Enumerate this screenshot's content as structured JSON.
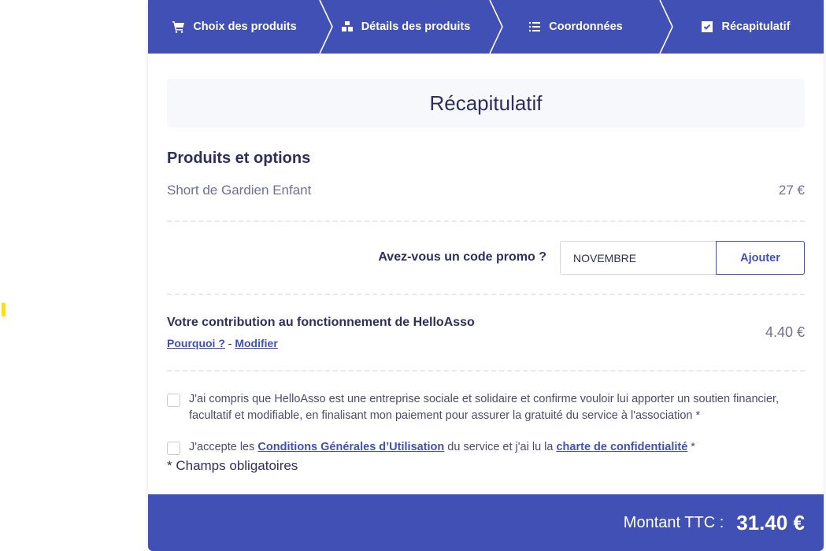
{
  "stepper": {
    "steps": [
      {
        "label": "Choix des produits",
        "icon": "cart-icon"
      },
      {
        "label": "Détails des produits",
        "icon": "boxes-icon"
      },
      {
        "label": "Coordonnées",
        "icon": "list-icon"
      },
      {
        "label": "Récapitulatif",
        "icon": "check-square-icon"
      }
    ]
  },
  "summary": {
    "title": "Récapitulatif",
    "section_title": "Produits et options",
    "product": {
      "name": "Short de Gardien Enfant",
      "price": "27 €"
    }
  },
  "promo": {
    "label": "Avez-vous un code promo ?",
    "value": "NOVEMBRE",
    "button_label": "Ajouter"
  },
  "contribution": {
    "title": "Votre contribution au fonctionnement de HelloAsso",
    "why_link": "Pourquoi ?",
    "separator": "-",
    "modify_link": "Modifier",
    "amount": "4.40 €"
  },
  "consents": {
    "first_line1": "J'ai compris que HelloAsso est une entreprise sociale et solidaire et confirme vouloir lui apporter un soutien financier,",
    "first_line2": "facultatif et modifiable, en finalisant mon paiement pour assurer la gratuité du service à l'association *",
    "second_prefix": "J'accepte les ",
    "second_cgu_link": "Conditions Générales d’Utilisation",
    "second_middle": " du service et j'ai lu la ",
    "second_privacy_link": "charte de confidentialité",
    "second_suffix": " *",
    "required_note": "* Champs obligatoires"
  },
  "footer": {
    "label": "Montant TTC :",
    "amount": "31.40 €"
  },
  "colors": {
    "primary": "#4050b5",
    "text": "#2e2f5e",
    "muted": "#6e7190",
    "accent_mark": "#ffe300"
  }
}
